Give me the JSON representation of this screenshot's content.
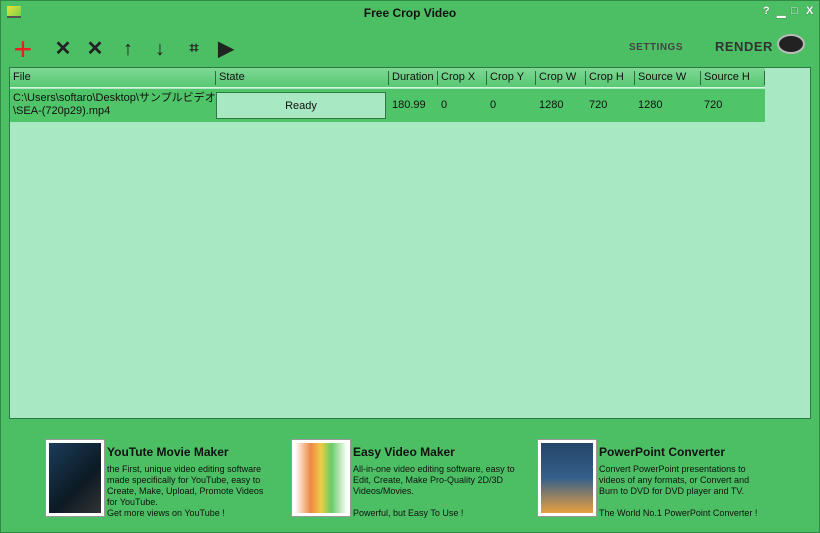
{
  "window": {
    "title": "Free Crop Video",
    "help": "?",
    "minimize": "▁",
    "maximize": "□",
    "close": "X"
  },
  "toolbar": {
    "settings_label": "SETTINGS",
    "render_label": "RENDER",
    "add_color": "#e82020"
  },
  "table": {
    "columns": [
      "File",
      "State",
      "Duration",
      "Crop X",
      "Crop Y",
      "Crop W",
      "Crop H",
      "Source W",
      "Source H"
    ],
    "rows": [
      {
        "file": "C:\\Users\\softaro\\Desktop\\サンプルビデオ\n\\SEA-(720p29).mp4",
        "state": "Ready",
        "duration": "180.99",
        "crop_x": "0",
        "crop_y": "0",
        "crop_w": "1280",
        "crop_h": "720",
        "source_w": "1280",
        "source_h": "720"
      }
    ]
  },
  "ads": [
    {
      "title": "YouTute Movie Maker",
      "desc": "the First, unique video editing software\nmade specifically for YouTube, easy to\nCreate, Make, Upload, Promote Videos\nfor YouTube.\nGet more views on YouTube !"
    },
    {
      "title": "Easy Video Maker",
      "desc": "All-in-one video editing software, easy to\nEdit, Create, Make Pro-Quality 2D/3D\nVideos/Movies.\n\nPowerful, but Easy To Use !"
    },
    {
      "title": "PowerPoint Converter",
      "desc": "Convert PowerPoint presentations to\nvideos of any formats, or Convert and\nBurn to DVD for DVD player and TV.\n\nThe World No.1 PowerPoint Converter !"
    }
  ]
}
